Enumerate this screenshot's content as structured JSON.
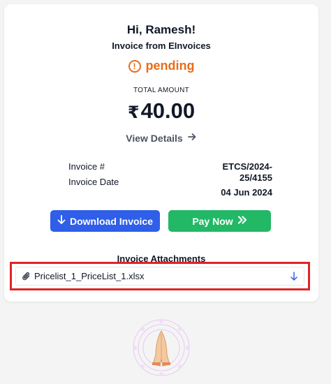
{
  "greeting": "Hi, Ramesh!",
  "invoice_from": "Invoice from EInvoices",
  "status": {
    "icon": "exclamation-circle-icon",
    "text": "pending",
    "color": "#ea6c1a"
  },
  "total": {
    "label": "TOTAL AMOUNT",
    "currency": "₹",
    "amount": "40.00"
  },
  "view_details": {
    "label": "View Details",
    "icon": "arrow-right-icon"
  },
  "details": {
    "invoice_no_label": "Invoice #",
    "invoice_no_value_line1": "ETCS/2024-",
    "invoice_no_value_line2": "25/4155",
    "invoice_date_label": "Invoice Date",
    "invoice_date_value": "04 Jun 2024"
  },
  "buttons": {
    "download": {
      "label": "Download Invoice",
      "icon": "arrow-down-icon",
      "color": "#2f5ee8"
    },
    "pay": {
      "label": "Pay Now",
      "icon": "double-chevron-right-icon",
      "color": "#22b866"
    }
  },
  "attachments": {
    "title": "Invoice Attachments",
    "items": [
      {
        "name": "Pricelist_1_PriceList_1.xlsx",
        "icon": "paperclip-icon",
        "action_icon": "arrow-down-icon"
      }
    ],
    "highlight_color": "#e02424"
  },
  "footer_logo": "namaste-hands-logo"
}
